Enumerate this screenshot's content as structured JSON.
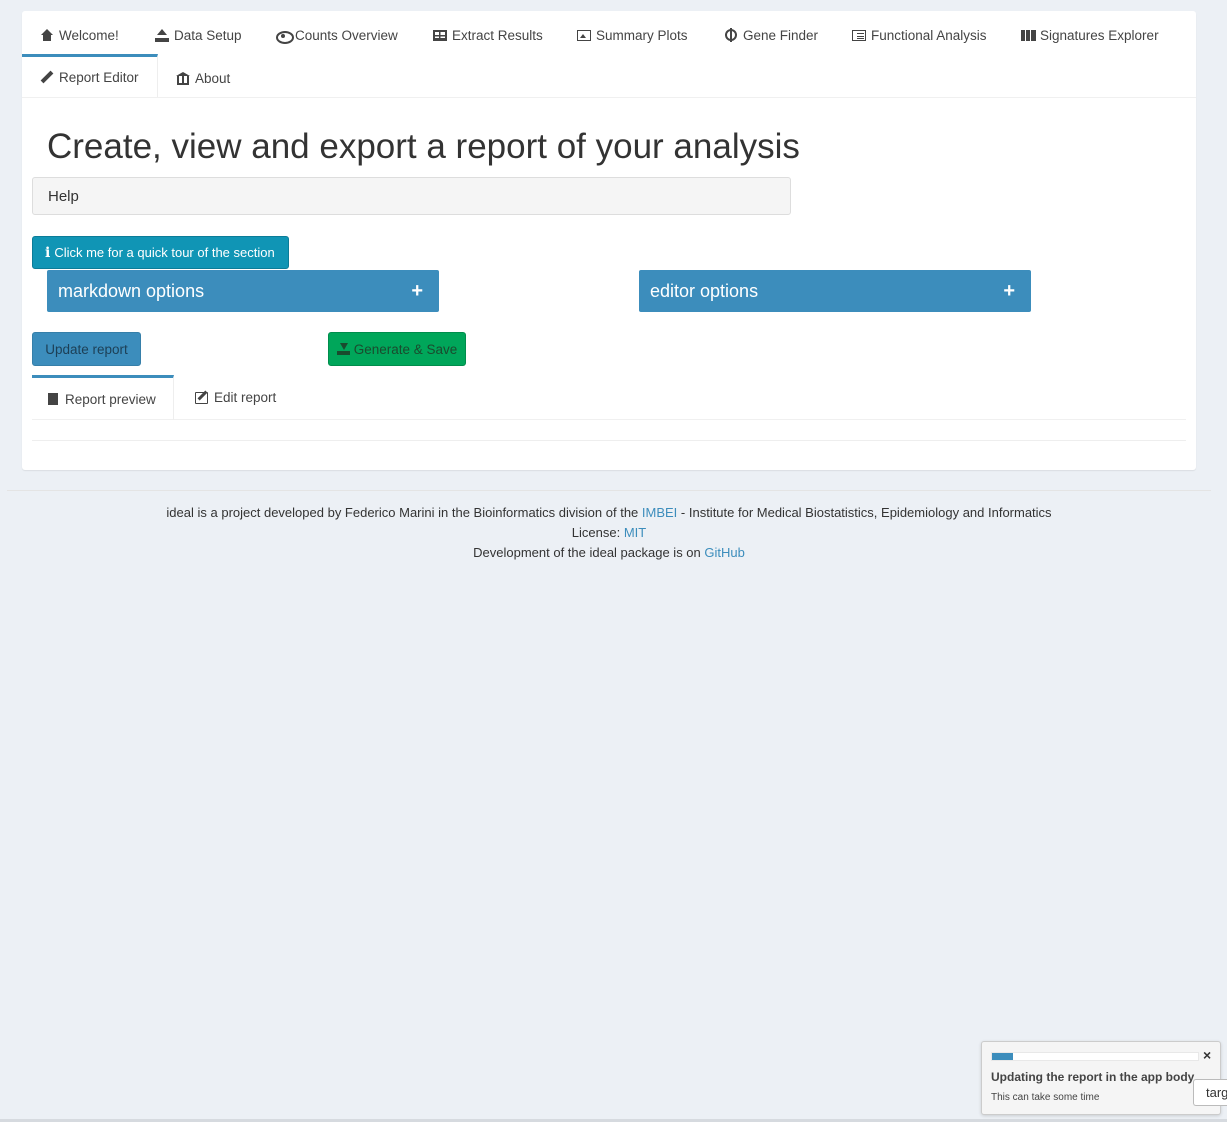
{
  "nav": {
    "tabs": [
      {
        "label": "Welcome!",
        "icon": "home-icon"
      },
      {
        "label": "Data Setup",
        "icon": "upload-icon"
      },
      {
        "label": "Counts Overview",
        "icon": "eye-icon"
      },
      {
        "label": "Extract Results",
        "icon": "table-icon"
      },
      {
        "label": "Summary Plots",
        "icon": "image-icon"
      },
      {
        "label": "Gene Finder",
        "icon": "crosshairs-icon"
      },
      {
        "label": "Functional Analysis",
        "icon": "list-alt-icon"
      },
      {
        "label": "Signatures Explorer",
        "icon": "map-icon"
      },
      {
        "label": "Report Editor",
        "icon": "pencil-icon"
      },
      {
        "label": "About",
        "icon": "institution-icon"
      }
    ],
    "active_tab": "Report Editor"
  },
  "main": {
    "title": "Create, view and export a report of your analysis",
    "help_label": "Help",
    "tour_button": "Click me for a quick tour of the section",
    "markdown_options": "markdown options",
    "editor_options": "editor options",
    "plus": "+",
    "update_button": "Update report",
    "generate_button": "Generate & Save",
    "subtabs": [
      {
        "label": "Report preview",
        "icon": "file-icon"
      },
      {
        "label": "Edit report",
        "icon": "edit-icon"
      }
    ],
    "active_subtab": "Report preview"
  },
  "footer": {
    "line1_pre": "ideal is a project developed by Federico Marini in the Bioinformatics division of the ",
    "line1_link": "IMBEI",
    "line1_post": " - Institute for Medical Biostatistics, Epidemiology and Informatics",
    "line2_pre": "License: ",
    "line2_link": "MIT",
    "line3_pre": "Development of the ideal package is on ",
    "line3_link": "GitHub"
  },
  "notification": {
    "message": "Updating the report in the app body",
    "detail": "This can take some time",
    "progress": 0.1,
    "close": "×"
  },
  "target_chip": "targ",
  "colors": {
    "primary": "#3c8dbc",
    "info": "#1095b5",
    "success": "#00a65a",
    "background": "#ecf0f5"
  }
}
